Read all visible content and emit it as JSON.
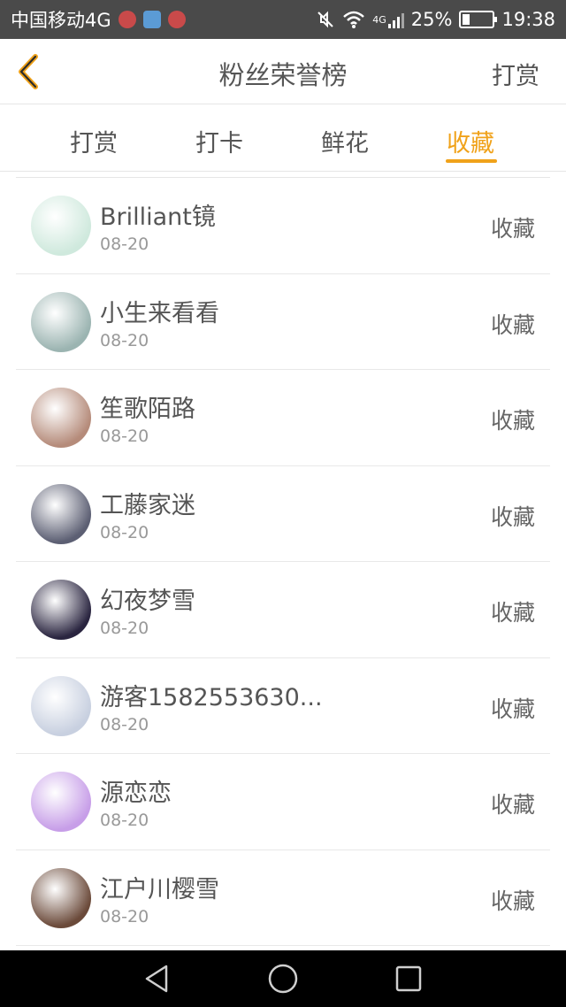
{
  "status_bar": {
    "carrier": "中国移动4G",
    "network": "4G",
    "battery": "25%",
    "battery_level": 0.25,
    "time": "19:38",
    "icons": [
      "app-icon-red",
      "app-icon-blue",
      "app-icon-red",
      "mute-icon",
      "wifi-icon",
      "signal-icon",
      "battery-icon"
    ]
  },
  "header": {
    "back_icon": "chevron-left-icon",
    "title": "粉丝荣誉榜",
    "action": "打赏"
  },
  "tabs": [
    {
      "label": "打赏",
      "active": false
    },
    {
      "label": "打卡",
      "active": false
    },
    {
      "label": "鲜花",
      "active": false
    },
    {
      "label": "收藏",
      "active": true
    }
  ],
  "accent_color": "#f0a21a",
  "fans": [
    {
      "name": "Brilliant镜",
      "date": "08-20",
      "action": "收藏",
      "avatar_color": "#cfe9dd"
    },
    {
      "name": "小生来看看",
      "date": "08-20",
      "action": "收藏",
      "avatar_color": "#9bb4b1"
    },
    {
      "name": "笙歌陌路",
      "date": "08-20",
      "action": "收藏",
      "avatar_color": "#b58b7a"
    },
    {
      "name": "工藤家迷",
      "date": "08-20",
      "action": "收藏",
      "avatar_color": "#5c5f73"
    },
    {
      "name": "幻夜梦雪",
      "date": "08-20",
      "action": "收藏",
      "avatar_color": "#2a2540"
    },
    {
      "name": "游客1582553630...",
      "date": "08-20",
      "action": "收藏",
      "avatar_color": "#c8d0e0"
    },
    {
      "name": "源恋恋",
      "date": "08-20",
      "action": "收藏",
      "avatar_color": "#c79ee8"
    },
    {
      "name": "江户川樱雪",
      "date": "08-20",
      "action": "收藏",
      "avatar_color": "#6b4a3a"
    }
  ],
  "nav_bar": {
    "icons": [
      "back-triangle-icon",
      "home-circle-icon",
      "recents-square-icon"
    ]
  }
}
